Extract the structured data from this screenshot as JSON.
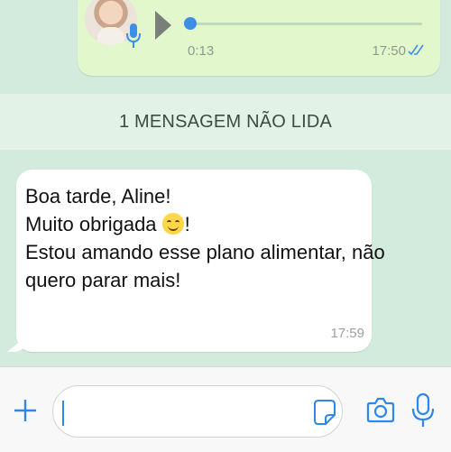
{
  "voice_message": {
    "duration": "0:13",
    "time": "17:50",
    "progress": 0.0,
    "status_icon": "double-check-read-icon"
  },
  "unread_banner": {
    "label": "1 MENSAGEM NÃO LIDA"
  },
  "text_message": {
    "line1": "Boa tarde, Aline!",
    "line2_text": "Muito obrigada",
    "line2_emoji": "smiling-face-emoji",
    "line2_end": "!",
    "line3": "Estou amando esse plano alimentar, não",
    "line4": "quero parar mais!",
    "time": "17:59"
  },
  "input_bar": {
    "text_value": "",
    "icons": [
      "plus-icon",
      "sticker-icon",
      "camera-icon",
      "microphone-icon"
    ]
  },
  "colors": {
    "chat_background": "#d3ebdc",
    "outgoing_bubble": "#e2f7cb",
    "incoming_bubble": "#ffffff",
    "accent_blue": "#2f87e8"
  }
}
